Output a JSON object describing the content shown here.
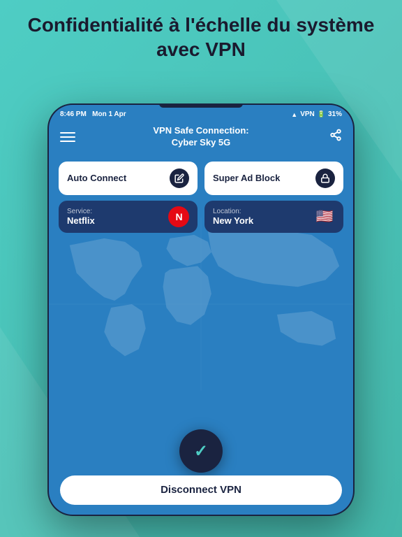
{
  "page": {
    "background_color": "#4ecdc4",
    "header": {
      "title": "Confidentialité à l'échelle du système avec VPN"
    }
  },
  "status_bar": {
    "time": "8:46 PM",
    "date": "Mon 1 Apr",
    "wifi": "VPN",
    "battery": "31%"
  },
  "nav": {
    "title_line1": "VPN Safe Connection:",
    "title_line2": "Cyber Sky 5G",
    "menu_icon": "☰",
    "share_icon": "⬆"
  },
  "features": {
    "auto_connect": {
      "label": "Auto Connect",
      "icon": "✏"
    },
    "super_ad_block": {
      "label": "Super Ad Block",
      "icon": "🔒"
    }
  },
  "service": {
    "label": "Service:",
    "value": "Netflix",
    "icon": "N"
  },
  "location": {
    "label": "Location:",
    "value": "New York",
    "flag": "🇺🇸"
  },
  "buttons": {
    "disconnect": "Disconnect VPN"
  }
}
